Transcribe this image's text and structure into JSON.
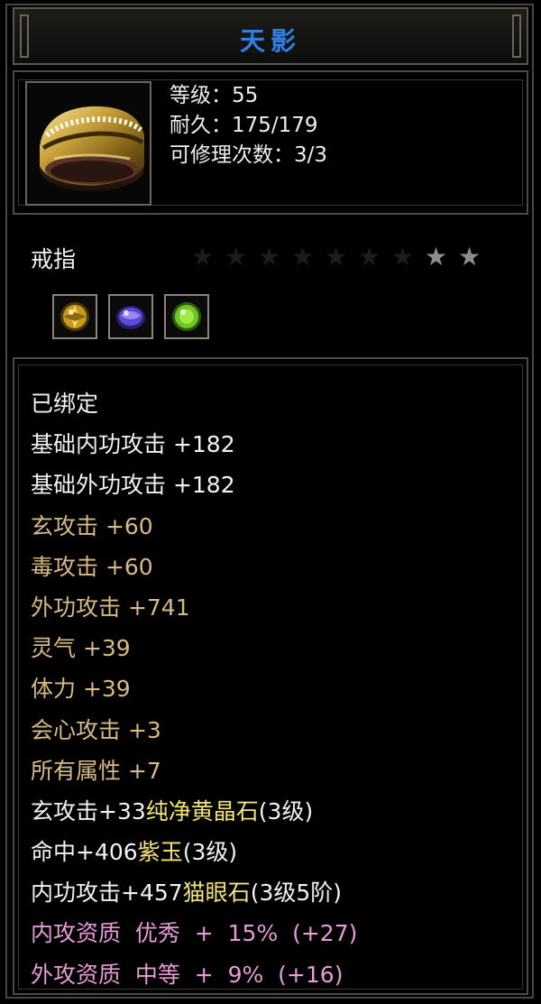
{
  "item": {
    "name": "天影",
    "level": "等级：55",
    "durability": "耐久：175/179",
    "repair": "可修理次数：3/3",
    "type": "戒指",
    "stars_total": 9,
    "stars_filled": 2
  },
  "gems": [
    {
      "icon": "yellow-crystal-gem-icon",
      "color": "#c8a020"
    },
    {
      "icon": "purple-jade-gem-icon",
      "color": "#5a4ad8"
    },
    {
      "icon": "cats-eye-gem-icon",
      "color": "#6cc828"
    }
  ],
  "attributes": {
    "bound": "已绑定",
    "base_inner": "基础内功攻击 +182",
    "base_outer": "基础外功攻击 +182",
    "xuan": "玄攻击 +60",
    "poison": "毒攻击 +60",
    "outer_atk": "外功攻击 +741",
    "spirit": "灵气 +39",
    "stamina": "体力 +39",
    "crit": "会心攻击 +3",
    "all_attr": "所有属性 +7",
    "gem1_stat": "玄攻击+33",
    "gem1_name": "纯净黄晶石",
    "gem1_level": "(3级)",
    "gem2_stat": "命中+406",
    "gem2_name": "紫玉",
    "gem2_level": "(3级)",
    "gem3_stat": "内功攻击+457",
    "gem3_name": "猫眼石",
    "gem3_level": "(3级5阶)",
    "inner_quality": "内攻资质  优秀  +  15%  (+27)",
    "outer_quality": "外攻资质  中等  +  9%  (+16)"
  },
  "colors": {
    "title": "#2f7fe8",
    "white": "#f2f2f2",
    "yellow": "#f4e27a",
    "orange": "#d9b982",
    "pink": "#e79ad8"
  }
}
